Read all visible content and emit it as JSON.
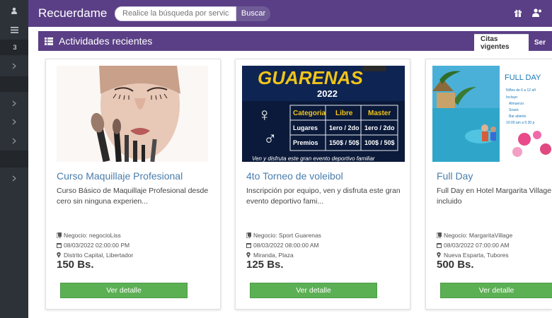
{
  "header": {
    "brand": "Recuerdame",
    "search_placeholder": "Realice la búsqueda por servicio",
    "search_button": "Buscar"
  },
  "sidebar": {
    "badge": "3"
  },
  "panel": {
    "title": "Actividades recientes",
    "tabs": [
      {
        "label": "Citas vigentes",
        "active": true
      },
      {
        "label": "Ser",
        "active": false
      }
    ]
  },
  "cards": [
    {
      "title": "Curso Maquillaje Profesional",
      "description": "Curso Básico de Maquillaje Profesional desde cero sin ninguna experien...",
      "business": "Negocio: negocioLiss",
      "datetime": "08/03/2022 02:00:00 PM",
      "location": "Distrito Capital, Libertador",
      "price": "150 Bs.",
      "button": "Ver detalle"
    },
    {
      "title": "4to Torneo de voleibol",
      "description": "Inscripción por equipo, ven y disfruta este gran evento deportivo fami...",
      "business": "Negocio: Sport Guarenas",
      "datetime": "08/03/2022 08:00:00 AM",
      "location": "Miranda, Plaza",
      "price": "125 Bs.",
      "button": "Ver detalle",
      "flyer": {
        "heading": "GUARENAS",
        "year": "2022",
        "headers": [
          "Categoria",
          "Libre",
          "Master"
        ],
        "rows": [
          [
            "Lugares",
            "1ero / 2do",
            "1ero / 2do"
          ],
          [
            "Premios",
            "150$ / 50$",
            "100$ / 50$"
          ]
        ],
        "footer": "Ven y disfruta este gran evento deportivo familiar"
      }
    },
    {
      "title": "Full Day",
      "description": "Full Day en Hotel Margarita Village incluido",
      "business": "Negocio: MargaritaVillage",
      "datetime": "08/03/2022 07:00:00 AM",
      "location": "Nueva Esparta, Tubores",
      "price": "500 Bs.",
      "button": "Ver detalle",
      "flyer": {
        "heading": "FULL DAY",
        "items": [
          "Niños de 6 a 12 añ",
          "Incluye:",
          "Almuerzo",
          "Snack",
          "Bar abierto",
          "10:00 am  a  5:30 p"
        ]
      }
    }
  ],
  "colors": {
    "header": "#5a3f86",
    "rail": "#2d3138",
    "link": "#4a7dab",
    "button": "#5cb054"
  }
}
